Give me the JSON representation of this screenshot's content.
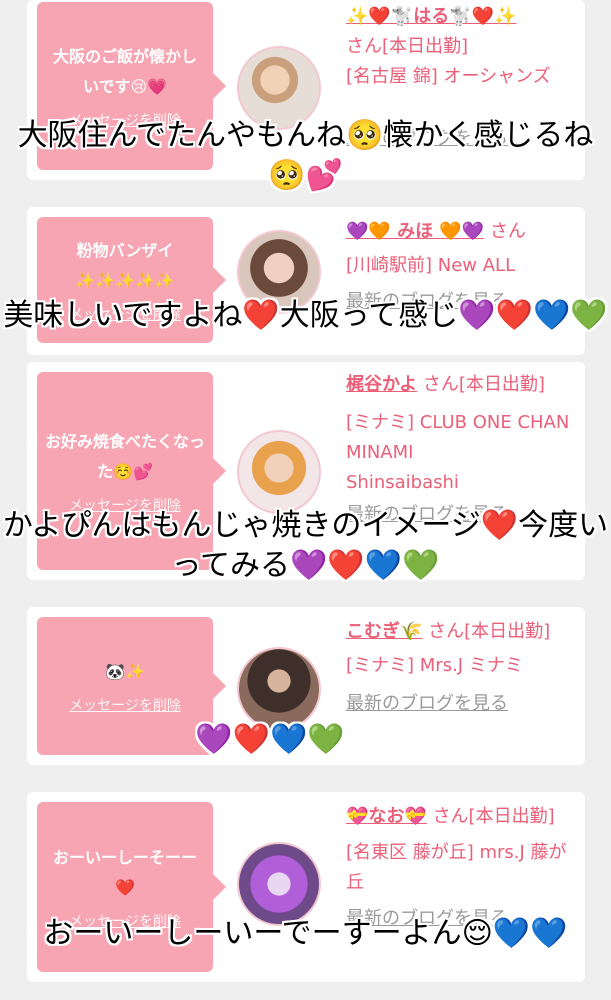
{
  "cards": [
    {
      "message": "大阪のご飯が懐かしいです😢💗",
      "delete": "メッセージを削除",
      "name": "✨❤️🐩はる🐩❤️✨",
      "suffix": "さん[本日出勤]",
      "area": "[名古屋 錦] オーシャンズ",
      "blog": "最新のブログを見る"
    },
    {
      "message": "粉物バンザイ",
      "message2": "✨✨✨✨✨",
      "delete": "メッセージを削除",
      "name": "💜🧡 みほ 🧡💜",
      "suffix": "さん",
      "area": "[川崎駅前] New ALL",
      "blog": "最新のブログを見る"
    },
    {
      "message": "お好み焼食べたくなった☺️💕",
      "delete": "メッセージを削除",
      "name": "梶谷かよ",
      "suffix": "さん[本日出勤]",
      "area": "[ミナミ] CLUB ONE CHAN MINAMI",
      "area2": "Shinsaibashi",
      "blog": "最新のブログを見る"
    },
    {
      "message": "🐼✨",
      "delete": "メッセージを削除",
      "name": "こむぎ🌾",
      "suffix": "さん[本日出勤]",
      "area": "[ミナミ] Mrs.J ミナミ",
      "blog": "最新のブログを見る"
    },
    {
      "message": "おーいーしーそーー❤️",
      "delete": "メッセージを削除",
      "name": "💝なお💝",
      "suffix": "さん[本日出勤]",
      "area": "[名東区 藤が丘] mrs.J 藤が丘",
      "blog": "最新のブログを見る"
    }
  ],
  "overlays": [
    "大阪住んでたんやもんね🥺懐かく感じるね🥺💕",
    "美味しいですよね❤️大阪って感じ💜❤️💙💚",
    "かよぴんはもんじゃ焼きのイメージ❤️今度いってみる💜❤️💙💚",
    "💜❤️💙💚",
    "おーいーしーいーでーすーよん😌💙💙"
  ]
}
